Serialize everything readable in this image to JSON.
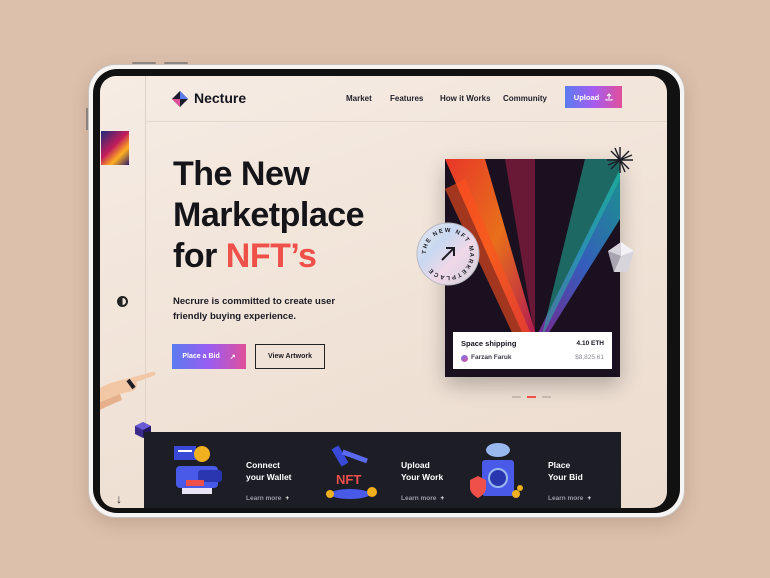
{
  "brand": {
    "name": "Necture"
  },
  "nav": {
    "links": [
      "Market",
      "Features",
      "How it Works",
      "Community"
    ],
    "upload_label": "Upload"
  },
  "hero": {
    "title_line1": "The New",
    "title_line2": "Marketplace",
    "title_line3_prefix": "for ",
    "title_line3_accent": "NFT’s",
    "subtitle": "Necrure is committed to create user friendly buying experience.",
    "place_bid_label": "Place a Bid",
    "view_artwork_label": "View Artwork"
  },
  "nft": {
    "name": "Space shipping",
    "price": "4.10 ETH",
    "owner": "Farzan Faruk",
    "usd": "$8,825.61",
    "badge_text": "THE NEW NFT MARKETPLACE"
  },
  "carousel": {
    "count": 3,
    "active_index": 1
  },
  "features": [
    {
      "title_line1": "Connect",
      "title_line2": "your Wallet",
      "more": "Learn more",
      "icon": "wallet-illustration"
    },
    {
      "title_line1": "Upload",
      "title_line2": "Your Work",
      "more": "Learn more",
      "icon": "nft-upload-illustration"
    },
    {
      "title_line1": "Place",
      "title_line2": "Your Bid",
      "more": "Learn more",
      "icon": "vault-illustration"
    }
  ],
  "colors": {
    "accent": "#f0504a",
    "gradient_start": "#5a7cf0",
    "gradient_end": "#e0509a",
    "dark_panel": "#1d1d26",
    "page_bg": "#dcc0ac"
  }
}
